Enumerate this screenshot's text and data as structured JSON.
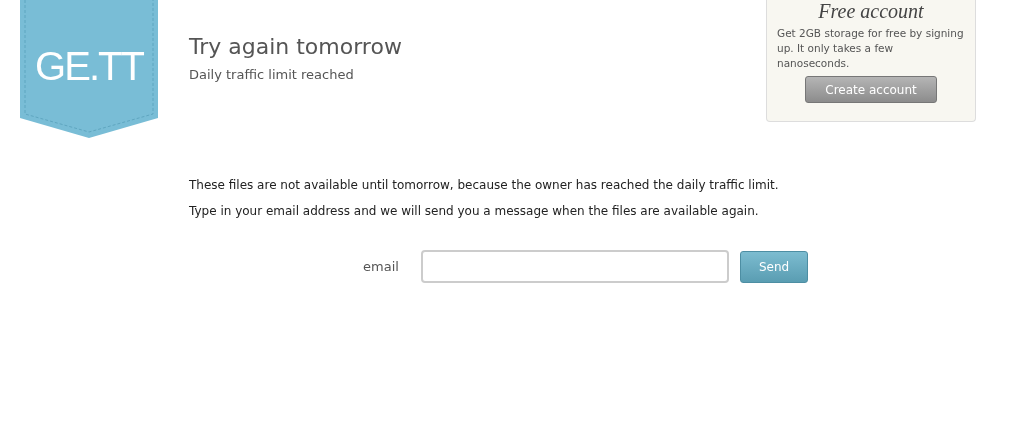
{
  "logo": {
    "text": "GE.TT"
  },
  "header": {
    "title": "Try again tomorrow",
    "subtitle": "Daily traffic limit reached"
  },
  "promo": {
    "title": "Free account",
    "text": "Get 2GB storage for free by signing up. It only takes a few nanoseconds.",
    "button": "Create account"
  },
  "message": [
    "These files are not available until tomorrow, because the owner has reached the daily traffic limit.",
    "Type in your email address and we will send you a message when the files are available again."
  ],
  "form": {
    "label": "email",
    "button": "Send"
  }
}
